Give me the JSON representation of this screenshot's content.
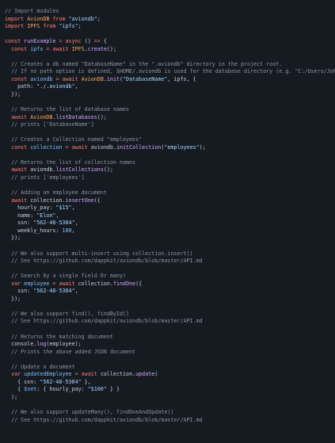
{
  "colors": {
    "background": "#161b22",
    "comment": "#8b949e",
    "keyword": "#ff7b72",
    "string": "#a5d6ff",
    "function": "#d2a8ff",
    "variable": "#ffa657",
    "property": "#79c0ff",
    "text": "#c9d1d9"
  },
  "code": {
    "lines": [
      [
        [
          "c",
          "// Import modules"
        ]
      ],
      [
        [
          "k",
          "import "
        ],
        [
          "v",
          "AvionDB"
        ],
        [
          "k",
          " from "
        ],
        [
          "s",
          "\"aviondb\""
        ],
        [
          "t",
          ";"
        ]
      ],
      [
        [
          "k",
          "import "
        ],
        [
          "v",
          "IPFS"
        ],
        [
          "k",
          " from "
        ],
        [
          "s",
          "\"ipfs\""
        ],
        [
          "t",
          ";"
        ]
      ],
      [],
      [
        [
          "k",
          "const "
        ],
        [
          "f",
          "runExample"
        ],
        [
          "k",
          " = async "
        ],
        [
          "t",
          "() "
        ],
        [
          "k",
          "=> "
        ],
        [
          "t",
          "{"
        ]
      ],
      [
        [
          "t",
          "  "
        ],
        [
          "k",
          "const "
        ],
        [
          "p",
          "ipfs"
        ],
        [
          "k",
          " = await "
        ],
        [
          "v",
          "IPFS"
        ],
        [
          "t",
          "."
        ],
        [
          "f",
          "create"
        ],
        [
          "t",
          "();"
        ]
      ],
      [],
      [
        [
          "t",
          "  "
        ],
        [
          "c",
          "// Creates a db named \"DatabaseName\" in the \".aviondb\" directory in the project root."
        ]
      ],
      [
        [
          "t",
          "  "
        ],
        [
          "c",
          "// If no path option is defined, $HOME/.aviondb is used for the database directory (e.g. \"C:/Users/John/.aviondb\" or \"~/.aviondb\")."
        ]
      ],
      [
        [
          "t",
          "  "
        ],
        [
          "k",
          "const "
        ],
        [
          "p",
          "aviondb"
        ],
        [
          "k",
          " = await "
        ],
        [
          "v",
          "AvionDB"
        ],
        [
          "t",
          "."
        ],
        [
          "f",
          "init"
        ],
        [
          "t",
          "("
        ],
        [
          "s",
          "\"DatabaseName\""
        ],
        [
          "t",
          ", ipfs, {"
        ]
      ],
      [
        [
          "t",
          "    path: "
        ],
        [
          "s",
          "\"./.aviondb\""
        ],
        [
          "t",
          ","
        ]
      ],
      [
        [
          "t",
          "  });"
        ]
      ],
      [],
      [
        [
          "t",
          "  "
        ],
        [
          "c",
          "// Returns the list of database names"
        ]
      ],
      [
        [
          "t",
          "  "
        ],
        [
          "k",
          "await "
        ],
        [
          "v",
          "AvionDB"
        ],
        [
          "t",
          "."
        ],
        [
          "f",
          "listDatabases"
        ],
        [
          "t",
          "();"
        ]
      ],
      [
        [
          "t",
          "  "
        ],
        [
          "c",
          "// prints ['DatabaseName']"
        ]
      ],
      [],
      [
        [
          "t",
          "  "
        ],
        [
          "c",
          "// Creates a Collection named \"employees\""
        ]
      ],
      [
        [
          "t",
          "  "
        ],
        [
          "k",
          "const "
        ],
        [
          "p",
          "collection"
        ],
        [
          "k",
          " = await "
        ],
        [
          "t",
          "aviondb."
        ],
        [
          "f",
          "initCollection"
        ],
        [
          "t",
          "("
        ],
        [
          "s",
          "\"employees\""
        ],
        [
          "t",
          ");"
        ]
      ],
      [],
      [
        [
          "t",
          "  "
        ],
        [
          "c",
          "// Returns the list of collection names"
        ]
      ],
      [
        [
          "t",
          "  "
        ],
        [
          "k",
          "await "
        ],
        [
          "t",
          "aviondb."
        ],
        [
          "f",
          "listCollections"
        ],
        [
          "t",
          "();"
        ]
      ],
      [
        [
          "t",
          "  "
        ],
        [
          "c",
          "// prints ['employees']"
        ]
      ],
      [],
      [
        [
          "t",
          "  "
        ],
        [
          "c",
          "// Adding an employee document"
        ]
      ],
      [
        [
          "t",
          "  "
        ],
        [
          "k",
          "await "
        ],
        [
          "t",
          "collection."
        ],
        [
          "f",
          "insertOne"
        ],
        [
          "t",
          "({"
        ]
      ],
      [
        [
          "t",
          "    hourly_pay: "
        ],
        [
          "s",
          "\"$15\""
        ],
        [
          "t",
          ","
        ]
      ],
      [
        [
          "t",
          "    name: "
        ],
        [
          "s",
          "\"Elon\""
        ],
        [
          "t",
          ","
        ]
      ],
      [
        [
          "t",
          "    ssn: "
        ],
        [
          "s",
          "\"562-48-5384\""
        ],
        [
          "t",
          ","
        ]
      ],
      [
        [
          "t",
          "    weekly_hours: "
        ],
        [
          "p",
          "100"
        ],
        [
          "t",
          ","
        ]
      ],
      [
        [
          "t",
          "  });"
        ]
      ],
      [],
      [
        [
          "t",
          "  "
        ],
        [
          "c",
          "// We also support multi-insert using collection.insert()"
        ]
      ],
      [
        [
          "t",
          "  "
        ],
        [
          "c",
          "// See https://github.com/dappkit/aviondb/blob/master/API.md"
        ]
      ],
      [],
      [
        [
          "t",
          "  "
        ],
        [
          "c",
          "// Search by a single field Or many!"
        ]
      ],
      [
        [
          "t",
          "  "
        ],
        [
          "k",
          "var "
        ],
        [
          "p",
          "employee"
        ],
        [
          "k",
          " = await "
        ],
        [
          "t",
          "collection."
        ],
        [
          "f",
          "findOne"
        ],
        [
          "t",
          "({"
        ]
      ],
      [
        [
          "t",
          "    ssn: "
        ],
        [
          "s",
          "\"562-48-5384\""
        ],
        [
          "t",
          ","
        ]
      ],
      [
        [
          "t",
          "  });"
        ]
      ],
      [],
      [
        [
          "t",
          "  "
        ],
        [
          "c",
          "// We also support find(), findById()"
        ]
      ],
      [
        [
          "t",
          "  "
        ],
        [
          "c",
          "// See https://github.com/dappkit/aviondb/blob/master/API.md"
        ]
      ],
      [],
      [
        [
          "t",
          "  "
        ],
        [
          "c",
          "// Returns the matching document"
        ]
      ],
      [
        [
          "t",
          "  console."
        ],
        [
          "f",
          "log"
        ],
        [
          "t",
          "(employee);"
        ]
      ],
      [
        [
          "t",
          "  "
        ],
        [
          "c",
          "// Prints the above added JSON document"
        ]
      ],
      [],
      [
        [
          "t",
          "  "
        ],
        [
          "c",
          "// Update a document"
        ]
      ],
      [
        [
          "t",
          "  "
        ],
        [
          "k",
          "var "
        ],
        [
          "p",
          "updatedEmployee"
        ],
        [
          "k",
          " = await "
        ],
        [
          "t",
          "collection."
        ],
        [
          "f",
          "update"
        ],
        [
          "t",
          "("
        ]
      ],
      [
        [
          "t",
          "    { ssn: "
        ],
        [
          "s",
          "\"562-48-5384\""
        ],
        [
          "t",
          " },"
        ]
      ],
      [
        [
          "t",
          "    { "
        ],
        [
          "p",
          "$set"
        ],
        [
          "t",
          ": { hourly_pay: "
        ],
        [
          "s",
          "\"$100\""
        ],
        [
          "t",
          " } }"
        ]
      ],
      [
        [
          "t",
          "  );"
        ]
      ],
      [],
      [
        [
          "t",
          "  "
        ],
        [
          "c",
          "// We also support updateMany(), findOneAndUpdate()"
        ]
      ],
      [
        [
          "t",
          "  "
        ],
        [
          "c",
          "// See https://github.com/dappkit/aviondb/blob/master/API.md"
        ]
      ]
    ]
  }
}
